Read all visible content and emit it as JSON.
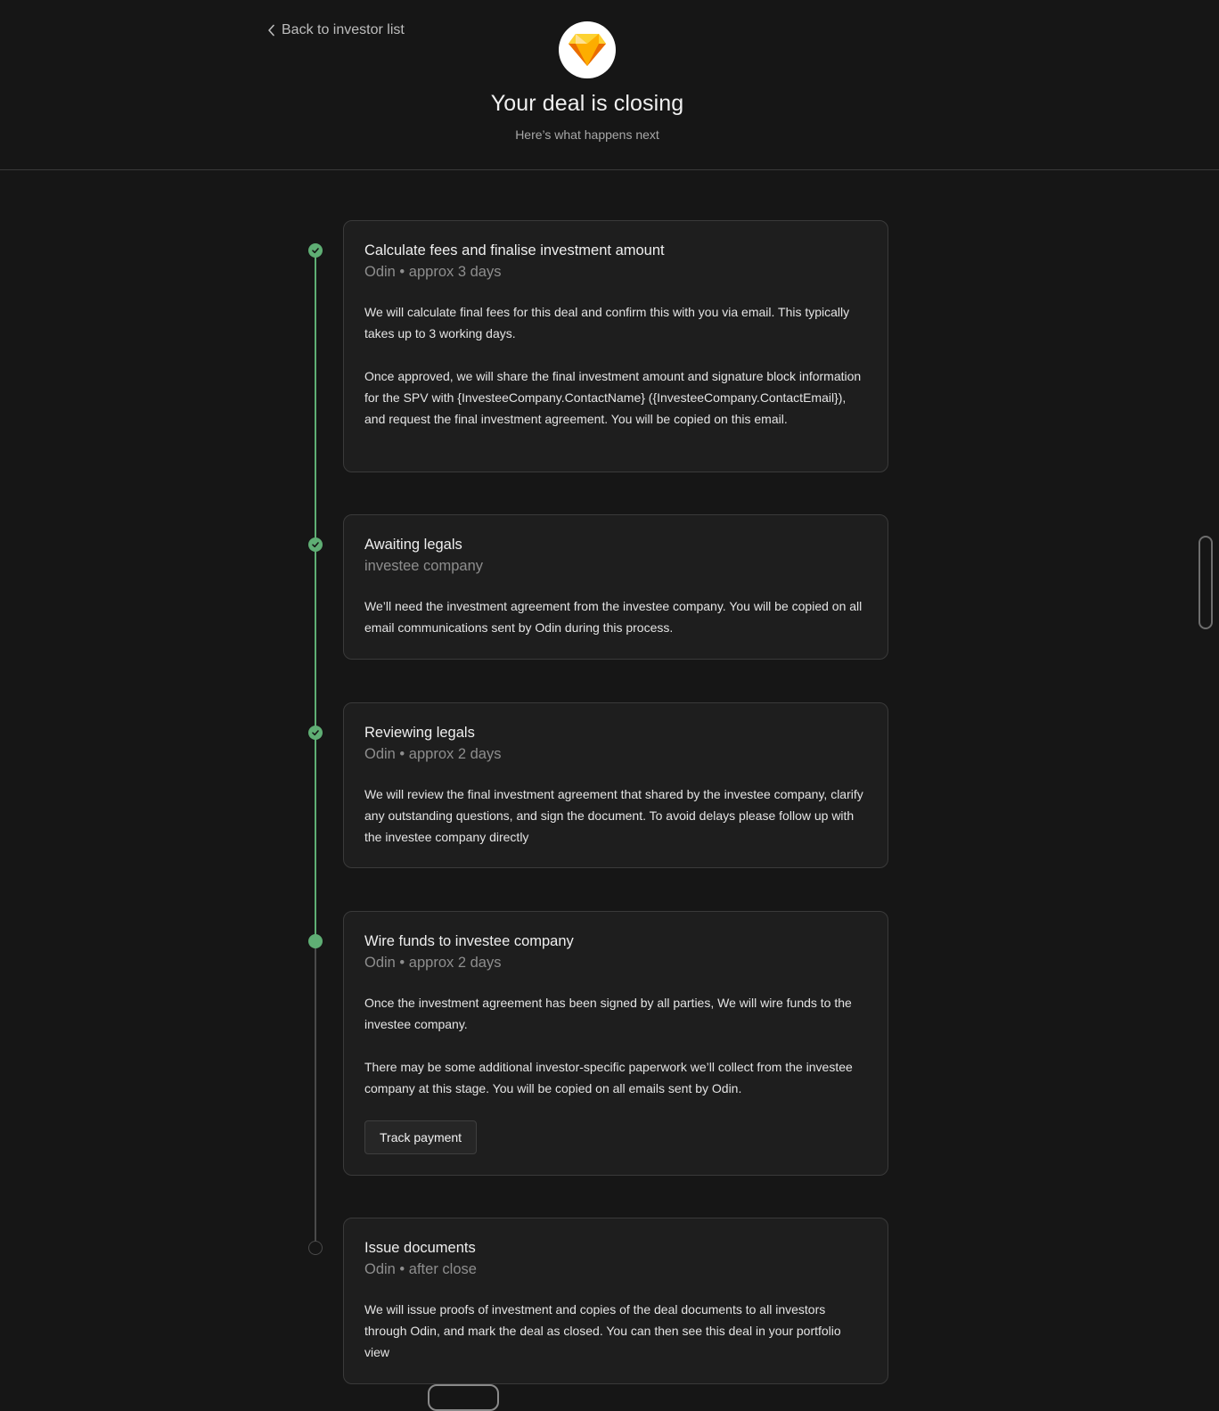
{
  "header": {
    "back_label": "Back to investor list",
    "title": "Your deal is closing",
    "subtitle": "Here’s what happens next"
  },
  "steps": [
    {
      "title": "Calculate fees and finalise investment amount",
      "meta": "Odin • approx 3 days",
      "status": "done",
      "paragraphs": [
        "We will calculate final fees for this deal and confirm this with you via email. This typically takes up to 3 working days.",
        "Once approved, we will share the final investment amount and signature block information for the SPV with {InvesteeCompany.ContactName} ({InvesteeCompany.ContactEmail}), and request the final investment agreement. You will be copied on this email."
      ]
    },
    {
      "title": "Awaiting legals",
      "meta": "investee company",
      "status": "done",
      "paragraphs": [
        "We’ll need the investment agreement from the investee company. You will be copied on all email communications sent by Odin during this process."
      ]
    },
    {
      "title": "Reviewing legals",
      "meta": "Odin • approx 2 days",
      "status": "done",
      "paragraphs": [
        "We will review the final investment agreement that  shared by the investee company, clarify any outstanding questions, and sign the document. To avoid delays please follow up with the investee company directly"
      ]
    },
    {
      "title": "Wire funds to investee company",
      "meta": "Odin • approx 2 days",
      "status": "current",
      "paragraphs": [
        "Once the investment agreement has been signed by all parties, We will wire funds to the investee company.",
        "There may be some additional investor-specific paperwork we’ll collect from the investee company at this stage. You will be copied on all emails sent by Odin."
      ],
      "button_label": "Track payment"
    },
    {
      "title": "Issue documents",
      "meta": "Odin • after close",
      "status": "pending",
      "paragraphs": [
        "We will issue proofs of investment and copies of the deal documents to all investors through Odin, and mark the deal as closed. You can then see this deal in your portfolio view"
      ]
    }
  ],
  "colors": {
    "background": "#161616",
    "card": "#1e1e1e",
    "accent_green": "#5fae74",
    "logo_orange": "#f5a623"
  },
  "icons": {
    "back": "chevron-left-icon",
    "logo": "diamond-logo-icon",
    "done": "check-icon"
  }
}
